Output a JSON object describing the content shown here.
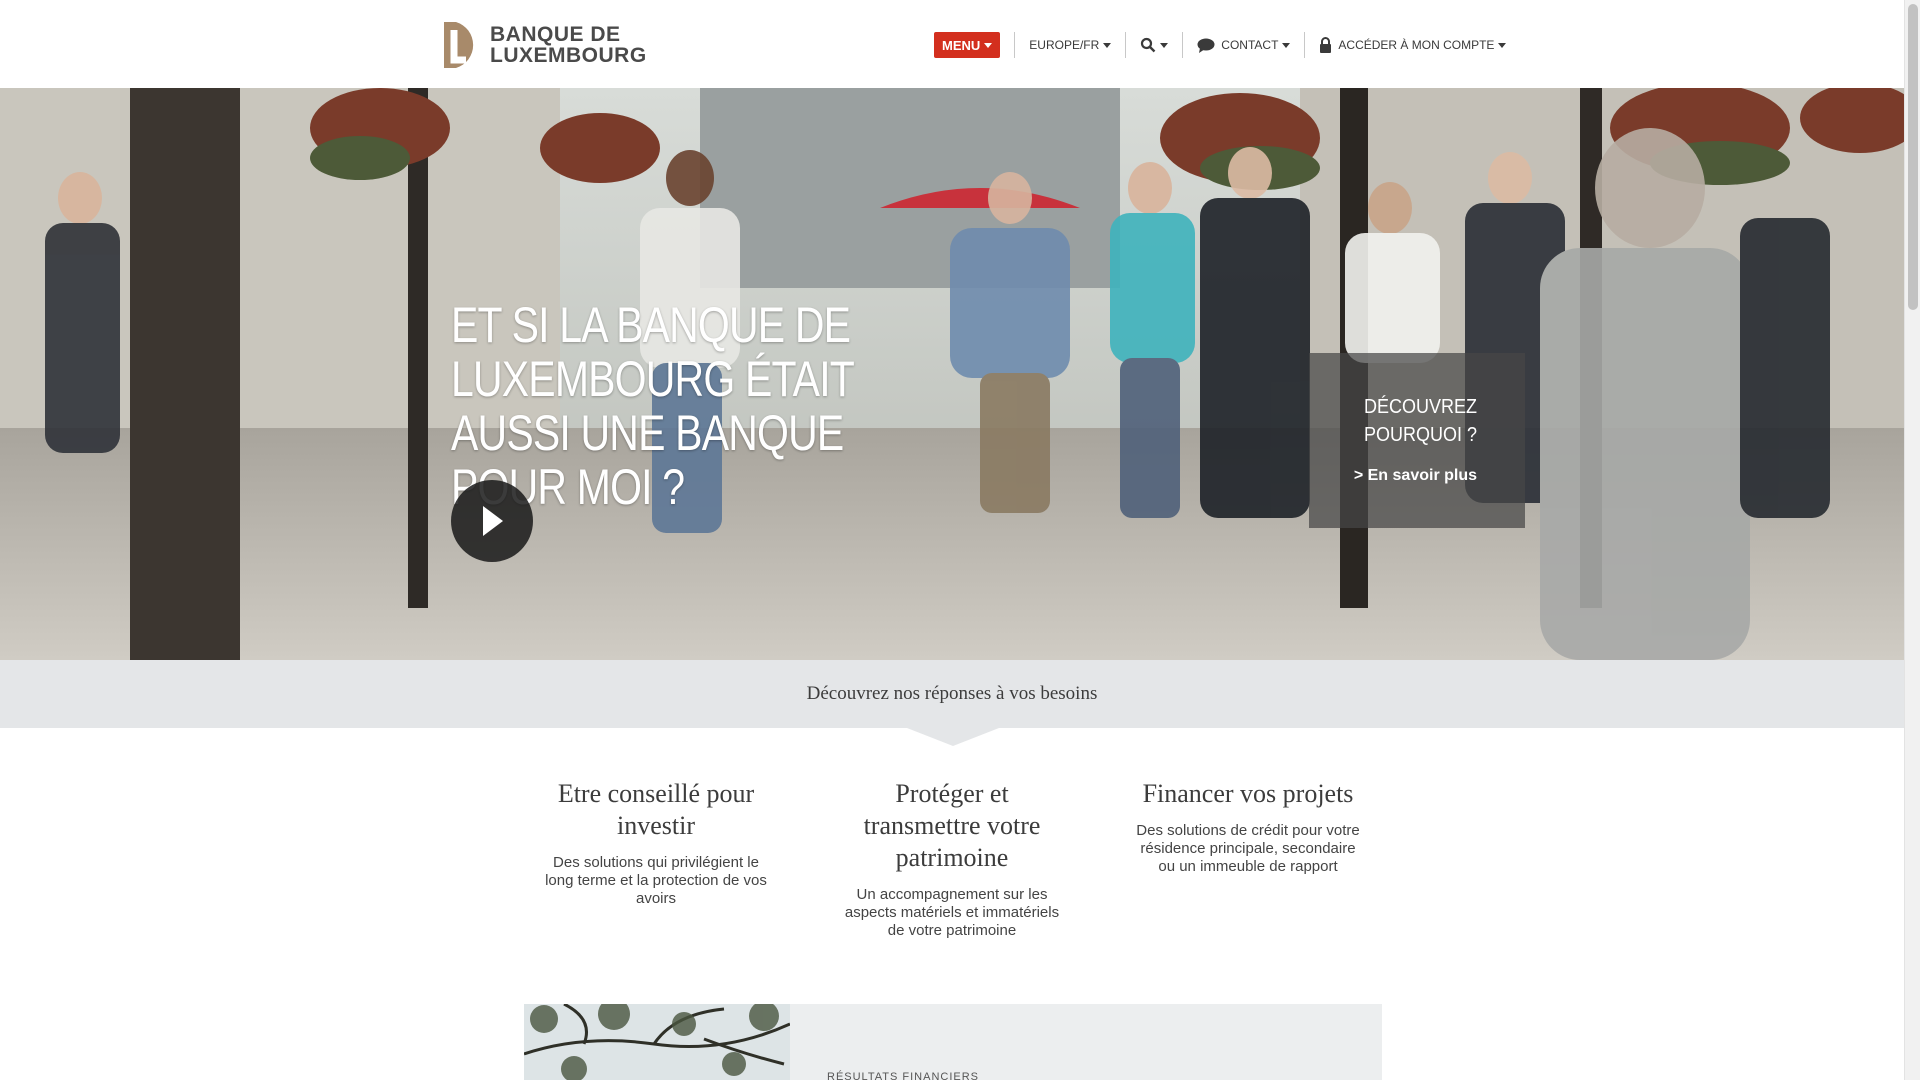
{
  "brand": {
    "line1": "BANQUE DE",
    "line2": "LUXEMBOURG",
    "color": "#a88a6a"
  },
  "nav": {
    "menu_label": "MENU",
    "region_label": "EUROPE/FR",
    "search_icon": "search-icon",
    "contact_label": "CONTACT",
    "account_label": "ACCÉDER À MON COMPTE",
    "accent": "#d32f1e"
  },
  "hero": {
    "title": "ET SI LA BANQUE DE LUXEMBOURG ÉTAIT AUSSI UNE BANQUE POUR MOI ?",
    "promo_title": "DÉCOUVREZ POURQUOI ?",
    "promo_link": "> En savoir plus"
  },
  "band": {
    "text": "Découvrez nos réponses à vos besoins"
  },
  "columns": [
    {
      "title": "Etre conseillé pour investir",
      "desc": "Des solutions qui privilégient le long terme et la protection de vos avoirs"
    },
    {
      "title": "Protéger et transmettre votre patrimoine",
      "desc": "Un accompagnement sur les aspects matériels et immatériels de votre patrimoine"
    },
    {
      "title": "Financer vos projets",
      "desc": "Des solutions de crédit pour votre résidence principale, secondaire ou un immeuble de rapport"
    }
  ],
  "teaser": {
    "label": "RÉSULTATS FINANCIERS"
  }
}
